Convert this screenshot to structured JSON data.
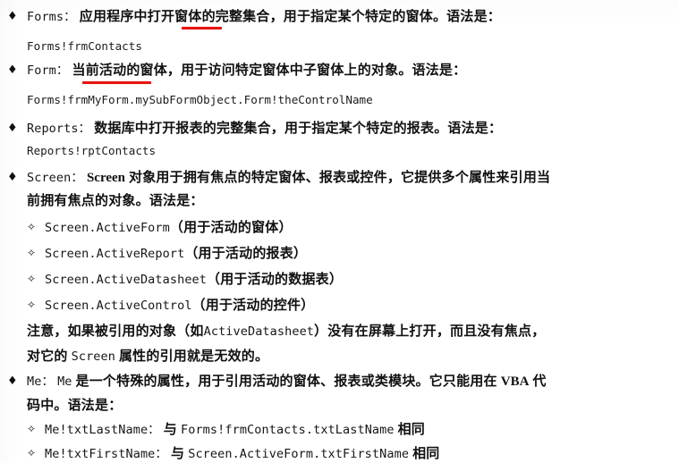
{
  "document": {
    "type": "scanned-book-page",
    "language": "zh-CN",
    "topic": "Microsoft Access VBA object reference syntax"
  },
  "bullets": {
    "main": "♦",
    "sub": "✧"
  },
  "colors": {
    "text": "#111111",
    "paper": "#ffffff",
    "annotation_red": "#e8130f"
  },
  "entries": [
    {
      "id": "forms",
      "term": "Forms：",
      "desc_before": "应用程序中",
      "desc_marked": "打开",
      "desc_after": "窗体的完整集合，用于指定某个特定的窗体。语法是：",
      "code": "Forms!frmContacts"
    },
    {
      "id": "form",
      "term": "Form：",
      "desc_marked": "当前活动",
      "desc_after": "的窗体，用于访问特定窗体中子窗体上的对象。语法是：",
      "code": "Forms!frmMyForm.mySubFormObject.Form!theControlName"
    },
    {
      "id": "reports",
      "term": "Reports：",
      "desc": "数据库中打开报表的完整集合，用于指定某个特定的报表。语法是：",
      "code": "Reports!rptContacts"
    },
    {
      "id": "screen",
      "term": "Screen：",
      "term2": "Screen",
      "desc_line1": "对象用于拥有焦点的特定窗体、报表或控件，它提供多个属性来引用当",
      "desc_line2": "前拥有焦点的对象。语法是：",
      "subitems": [
        {
          "code": "Screen.ActiveForm",
          "note": "（用于活动的窗体）"
        },
        {
          "code": "Screen.ActiveReport",
          "note": "（用于活动的报表）"
        },
        {
          "code": "Screen.ActiveDatasheet",
          "note": "（用于活动的数据表）"
        },
        {
          "code": "Screen.ActiveControl",
          "note": "（用于活动的控件）"
        }
      ],
      "note_line1_a": "注意，如果被引用的对象（如",
      "note_line1_code": "ActiveDatasheet",
      "note_line1_b": "）没有在屏幕上打开，而且没有焦点，",
      "note_line2_a": "对它的",
      "note_line2_code": "Screen",
      "note_line2_b": "属性的引用就是无效的。"
    },
    {
      "id": "me",
      "term": "Me：",
      "term2": "Me",
      "desc_line1": "是一个特殊的属性，用于引用活动的窗体、报表或类模块。它只能用在",
      "desc_line1_tail": "VBA",
      "desc_line1_tail2": "代",
      "desc_line2": "码中。语法是：",
      "subitems": [
        {
          "code": "Me!txtLastName：",
          "conj": "与",
          "code2": "Forms!frmContacts.txtLastName",
          "tail": "相同"
        },
        {
          "code": "Me!txtFirstName：",
          "conj": "与",
          "code2": "Screen.ActiveForm.txtFirstName",
          "tail": "相同"
        }
      ]
    }
  ]
}
